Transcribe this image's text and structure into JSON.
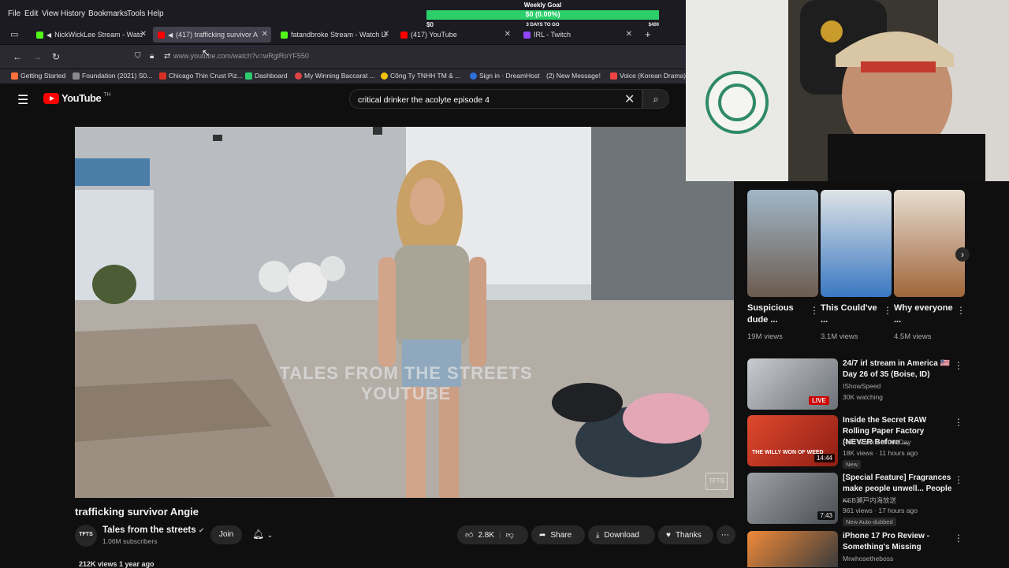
{
  "menu": [
    "File",
    "Edit",
    "View",
    "History",
    "Bookmarks",
    "Tools",
    "Help"
  ],
  "tabs": [
    {
      "label": "NickWickLee Stream - Watc",
      "color": "#53fc18"
    },
    {
      "label": "(417) trafficking survivor A",
      "color": "#ff0000"
    },
    {
      "label": "fatandbroke Stream - Watch Li",
      "color": "#53fc18"
    },
    {
      "label": "(417) YouTube",
      "color": "#ff0000"
    },
    {
      "label": "IRL - Twitch",
      "color": "#9146ff"
    }
  ],
  "url": "www.youtube.com/watch?v=wRglRoYF550",
  "bookmarks": [
    {
      "label": "Getting Started",
      "color": "#ff7139"
    },
    {
      "label": "Foundation (2021) S0...",
      "color": "#8a8a8a"
    },
    {
      "label": "Chicago Thin Crust Piz...",
      "color": "#d93025"
    },
    {
      "label": "Dashboard",
      "color": "#2ecc71"
    },
    {
      "label": "My Winning Baccarat ...",
      "color": "#e04444"
    },
    {
      "label": "Công Ty TNHH TM & ...",
      "color": "#f4c20d"
    },
    {
      "label": "Sign in · DreamHost",
      "color": "#2e6fd8"
    },
    {
      "label": "(2) New Message!",
      "color": "#777"
    },
    {
      "label": "Voice (Korean Drama)",
      "color": "#e44"
    }
  ],
  "goal": {
    "title": "Weekly Goal",
    "amount": "$0 (0.00%)",
    "left": "$0",
    "days": "3 DAYS TO GO",
    "right": "$400"
  },
  "yt": {
    "logo": "YouTube",
    "logo_sup": "TH",
    "search": "critical drinker the acolyte episode 4",
    "watermark_1": "TALES FROM THE STREETS",
    "watermark_2": "YOUTUBE",
    "corner_logo": "TFTS",
    "video_title": "trafficking survivor Angie",
    "channel_avatar": "TFTS",
    "channel": "Tales from the streets",
    "subs": "1.06M subscribers",
    "join": "Join",
    "likes": "2.8K",
    "share": "Share",
    "download": "Download",
    "thanks": "Thanks",
    "views": "212K views  1 year ago"
  },
  "shorts": [
    {
      "title": "Suspicious dude ...",
      "views": "19M views",
      "color": "#7e8d98"
    },
    {
      "title": "This Could've ...",
      "views": "3.1M views",
      "color": "#4d6f8f"
    },
    {
      "title": "Why everyone ...",
      "views": "4.5M views",
      "color": "#9a6a44"
    }
  ],
  "recs": [
    {
      "title": "24/7 irl stream in America 🇺🇸 Day 26 of 35 (Boise, ID)",
      "channel": "IShowSpeed",
      "meta": "30K watching",
      "badge": "",
      "live": "LIVE",
      "dur": "",
      "color": "#8a8f95"
    },
    {
      "title": "Inside the Secret RAW Rolling Paper Factory (NEVER Before ...",
      "channel": "First Smoke of the Day",
      "meta": "18K views · 11 hours ago",
      "badge": "New",
      "live": "",
      "dur": "14:44",
      "color": "#c7332a",
      "thumb_text": "THE WILLY WON OF WEED"
    },
    {
      "title": "[Special Feature] Fragrances make people unwell... People ...",
      "channel": "KSB瀬戸内海放送",
      "meta": "961 views · 17 hours ago",
      "badge": "New  Auto-dubbed",
      "live": "",
      "dur": "7:43",
      "color": "#6f7377"
    },
    {
      "title": "iPhone 17 Pro Review - Something's Missing",
      "channel": "Mrwhosetheboss",
      "meta": "",
      "badge": "",
      "live": "",
      "dur": "",
      "color": "#d86a2a"
    }
  ]
}
